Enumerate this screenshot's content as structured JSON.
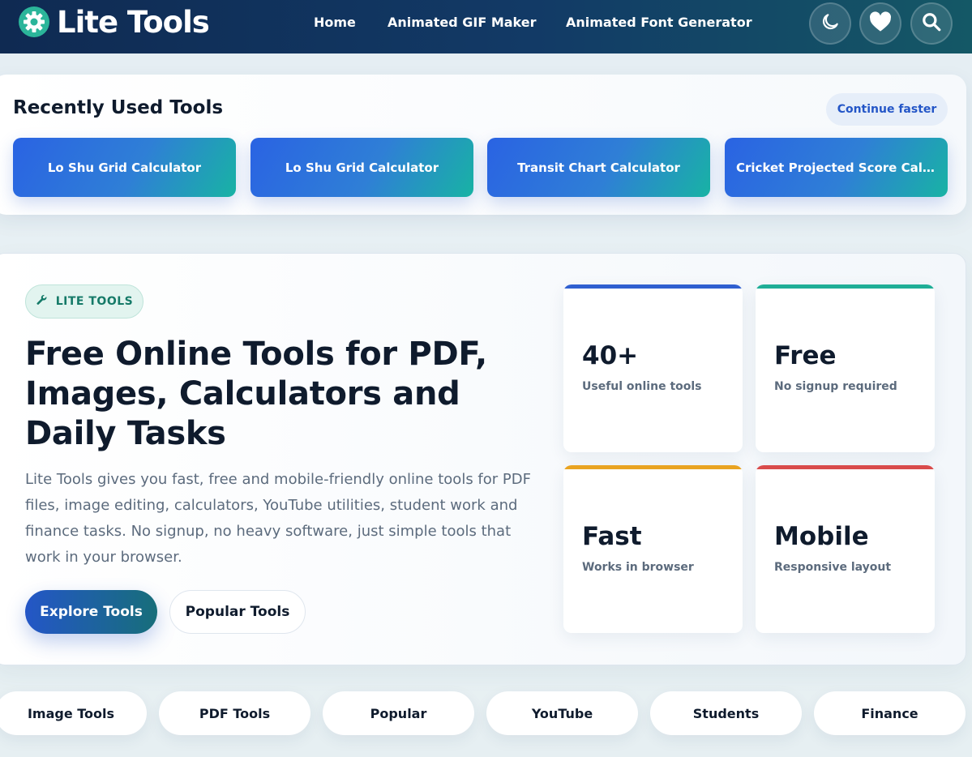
{
  "header": {
    "logo_text": "Lite Tools",
    "nav": [
      {
        "label": "Home"
      },
      {
        "label": "Animated GIF Maker"
      },
      {
        "label": "Animated Font Generator"
      }
    ],
    "icons": [
      "moon-icon",
      "heart-icon",
      "search-icon"
    ]
  },
  "recent": {
    "title": "Recently Used Tools",
    "continue_label": "Continue faster",
    "tools": [
      {
        "label": "Lo Shu Grid Calculator"
      },
      {
        "label": "Lo Shu Grid Calculator"
      },
      {
        "label": "Transit Chart Calculator"
      },
      {
        "label": "Cricket Projected Score Calculator"
      }
    ]
  },
  "hero": {
    "badge": "LITE TOOLS",
    "title": "Free Online Tools for PDF, Images, Calculators and Daily Tasks",
    "description": "Lite Tools gives you fast, free and mobile-friendly online tools for PDF files, image editing, calculators, YouTube utilities, student work and finance tasks. No signup, no heavy software, just simple tools that work in your browser.",
    "explore_label": "Explore Tools",
    "popular_label": "Popular Tools",
    "stats": [
      {
        "value": "40+",
        "label": "Useful online tools",
        "color": "#2f5fd0"
      },
      {
        "value": "Free",
        "label": "No signup required",
        "color": "#1fae97"
      },
      {
        "value": "Fast",
        "label": "Works in browser",
        "color": "#e9a321"
      },
      {
        "value": "Mobile",
        "label": "Responsive layout",
        "color": "#d94b4b"
      }
    ]
  },
  "categories": [
    {
      "label": "Image Tools"
    },
    {
      "label": "PDF Tools"
    },
    {
      "label": "Popular"
    },
    {
      "label": "YouTube"
    },
    {
      "label": "Students"
    },
    {
      "label": "Finance"
    }
  ],
  "colors": {
    "header_start": "#0f2a52",
    "header_end": "#145866",
    "primary": "#2456c7",
    "accent_teal": "#18b3a4"
  }
}
